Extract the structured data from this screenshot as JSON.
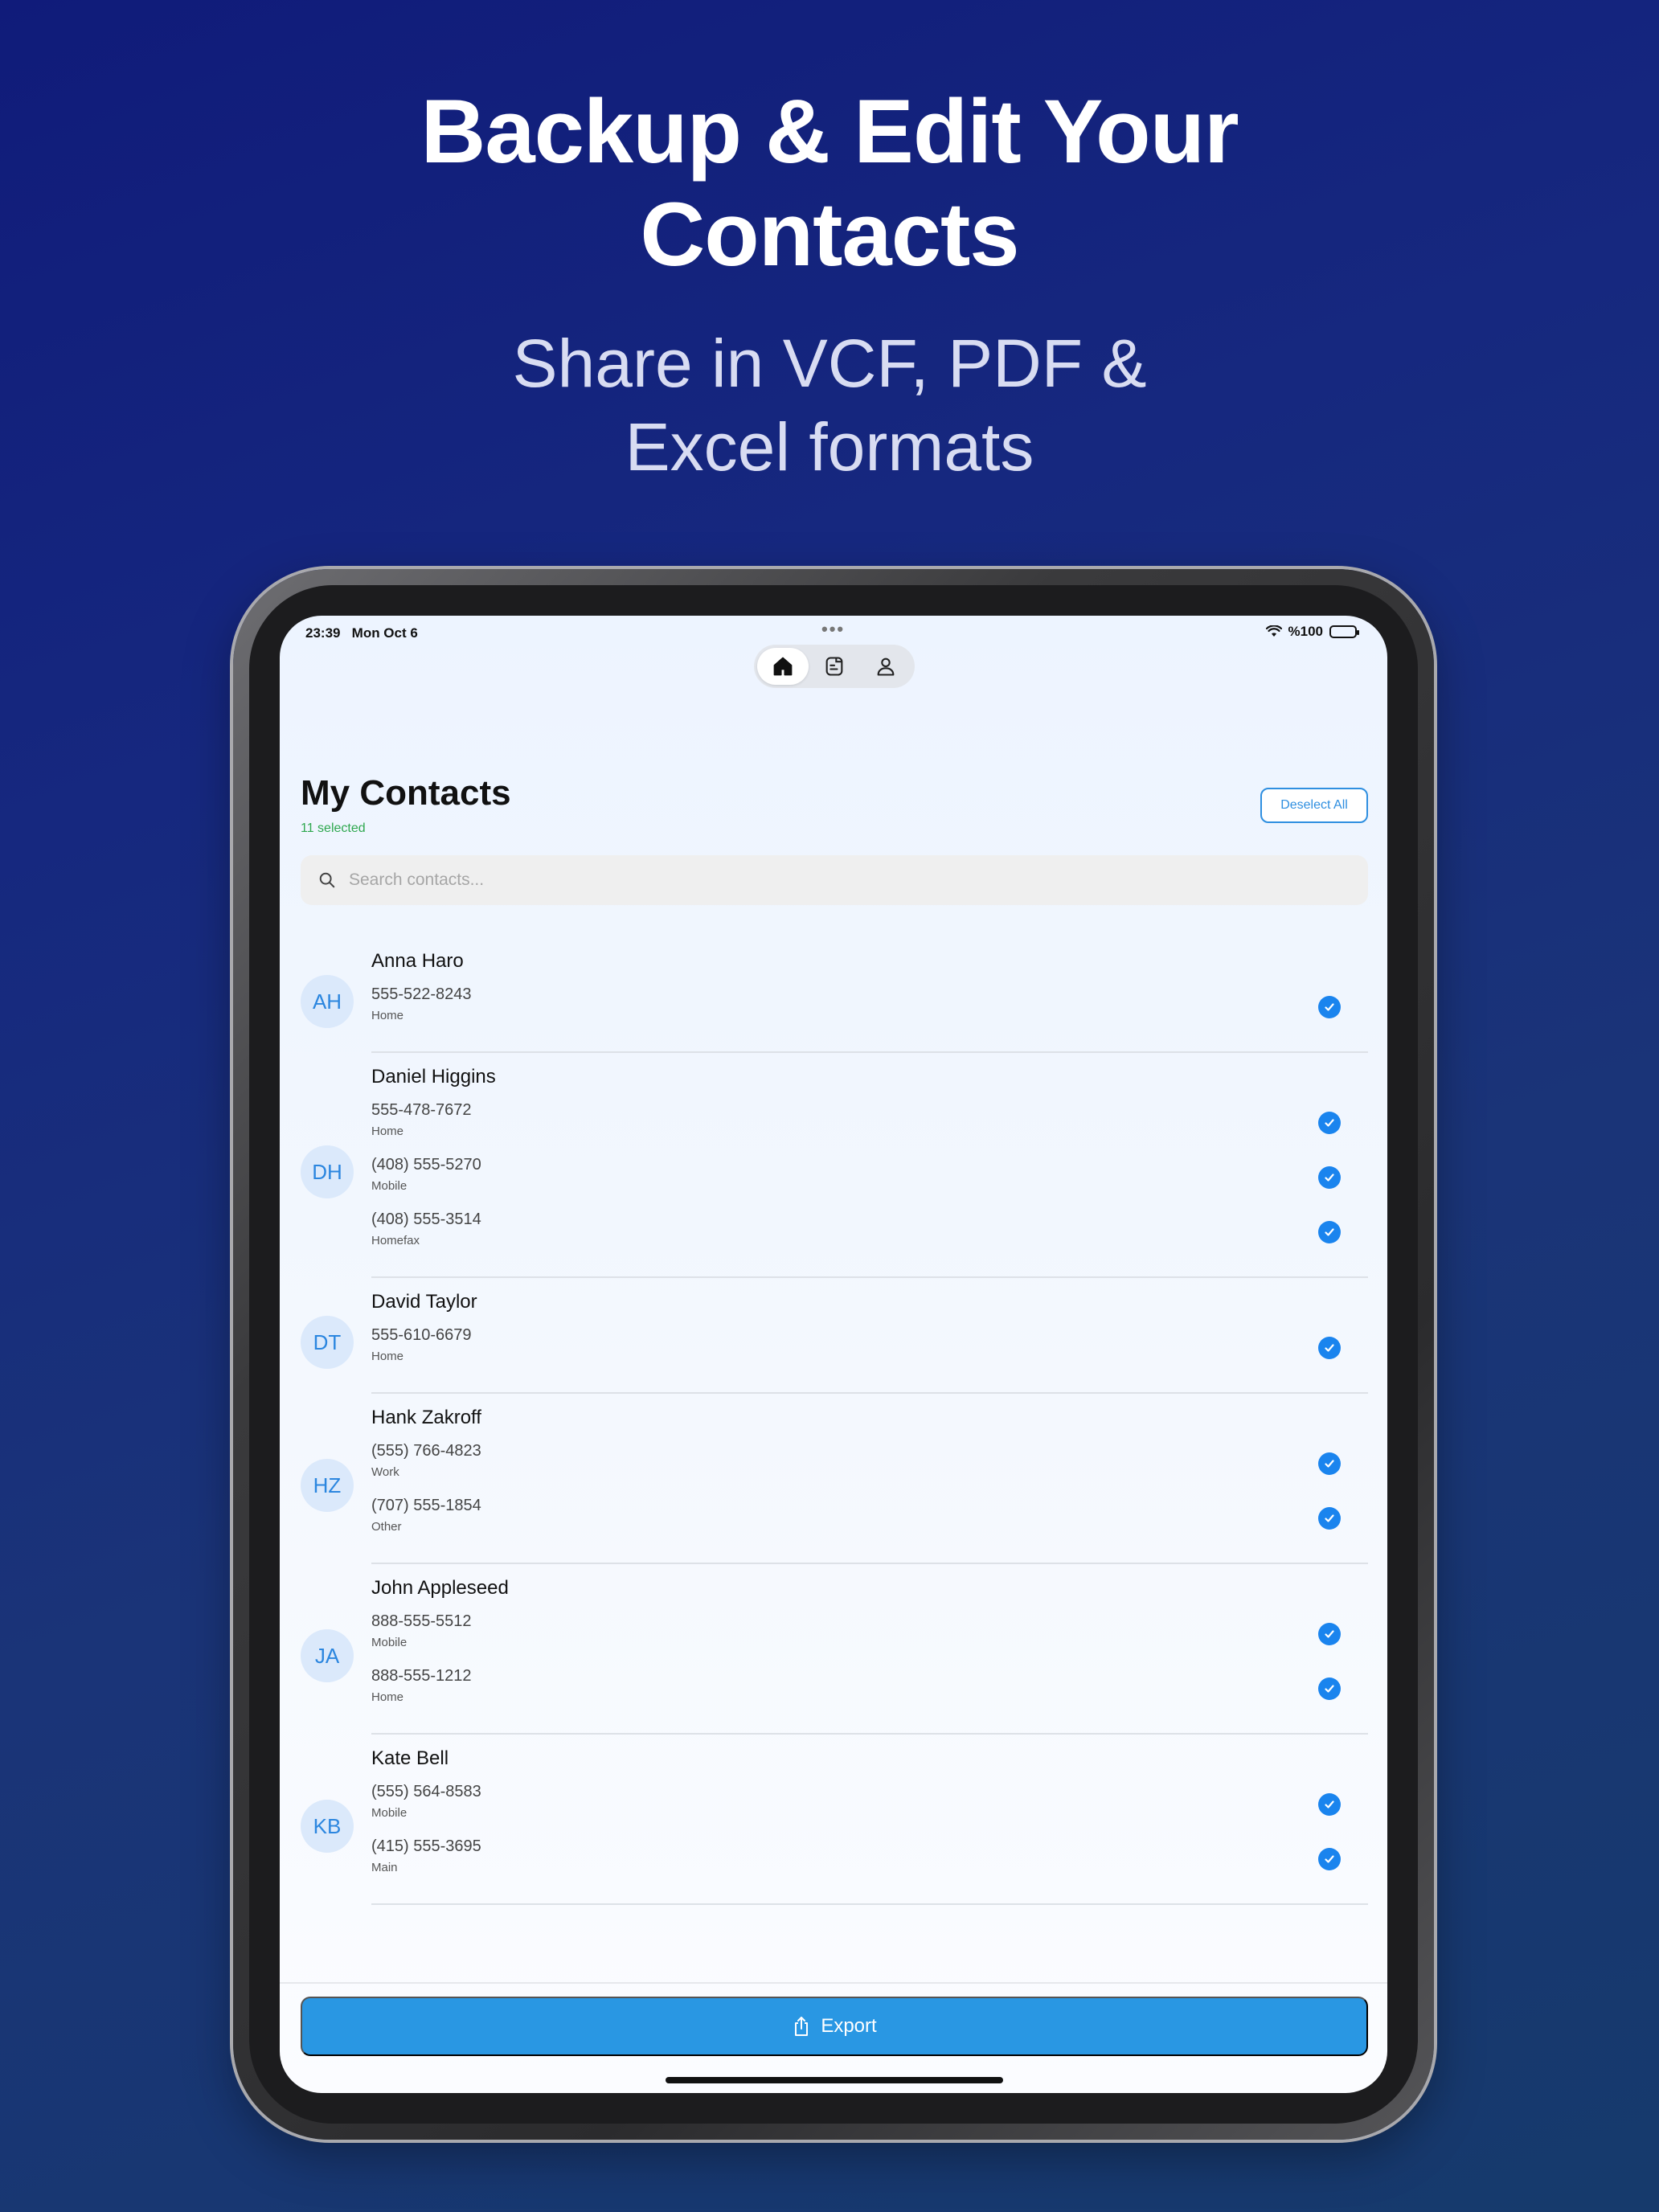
{
  "promo": {
    "headline_line1": "Backup & Edit Your",
    "headline_line2": "Contacts",
    "subline_line1": "Share in VCF, PDF &",
    "subline_line2": "Excel formats"
  },
  "status_bar": {
    "time": "23:39",
    "date": "Mon Oct 6",
    "battery": "%100"
  },
  "tabs": [
    {
      "icon": "home-icon",
      "active": true
    },
    {
      "icon": "document-icon",
      "active": false
    },
    {
      "icon": "person-icon",
      "active": false
    }
  ],
  "header": {
    "title": "My Contacts",
    "selected_count": "11 selected",
    "deselect_label": "Deselect All"
  },
  "search": {
    "placeholder": "Search contacts...",
    "value": ""
  },
  "contacts": [
    {
      "initials": "AH",
      "name": "Anna Haro",
      "phones": [
        {
          "number": "555-522-8243",
          "label": "Home",
          "checked": true
        }
      ]
    },
    {
      "initials": "DH",
      "name": "Daniel Higgins",
      "phones": [
        {
          "number": "555-478-7672",
          "label": "Home",
          "checked": true
        },
        {
          "number": "(408) 555-5270",
          "label": "Mobile",
          "checked": true
        },
        {
          "number": "(408) 555-3514",
          "label": "Homefax",
          "checked": true
        }
      ]
    },
    {
      "initials": "DT",
      "name": "David Taylor",
      "phones": [
        {
          "number": "555-610-6679",
          "label": "Home",
          "checked": true
        }
      ]
    },
    {
      "initials": "HZ",
      "name": "Hank Zakroff",
      "phones": [
        {
          "number": "(555) 766-4823",
          "label": "Work",
          "checked": true
        },
        {
          "number": "(707) 555-1854",
          "label": "Other",
          "checked": true
        }
      ]
    },
    {
      "initials": "JA",
      "name": "John Appleseed",
      "phones": [
        {
          "number": "888-555-5512",
          "label": "Mobile",
          "checked": true
        },
        {
          "number": "888-555-1212",
          "label": "Home",
          "checked": true
        }
      ]
    },
    {
      "initials": "KB",
      "name": "Kate Bell",
      "phones": [
        {
          "number": "(555) 564-8583",
          "label": "Mobile",
          "checked": true
        },
        {
          "number": "(415) 555-3695",
          "label": "Main",
          "checked": true
        }
      ]
    }
  ],
  "footer": {
    "export_label": "Export"
  },
  "colors": {
    "accent": "#2997E3",
    "check": "#1A84EE",
    "selected_text": "#2FA84F",
    "avatar_bg": "#DBE9FB"
  }
}
